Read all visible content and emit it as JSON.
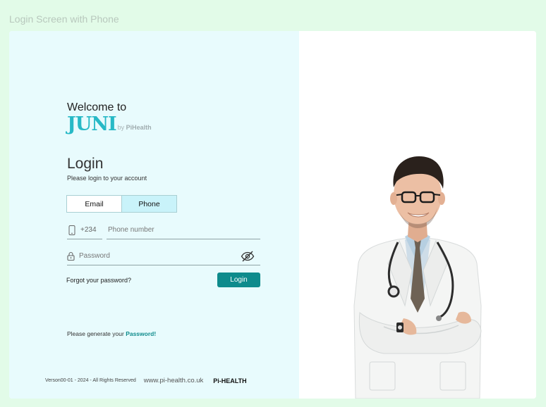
{
  "frame_title": "Login Screen with Phone",
  "welcome": "Welcome to",
  "brand": {
    "name": "JUNI",
    "by": "by",
    "sub": "PiHealth"
  },
  "login": {
    "title": "Login",
    "subtitle": "Please login to your account"
  },
  "tabs": [
    {
      "label": "Email",
      "active": false
    },
    {
      "label": "Phone",
      "active": true
    }
  ],
  "phone": {
    "country_code": "+234",
    "placeholder": "Phone number",
    "value": ""
  },
  "password": {
    "placeholder": "Password",
    "value": ""
  },
  "forgot_label": "Forgot your password?",
  "login_button": "Login",
  "generate": {
    "text": "Please generate your",
    "link": "Password!"
  },
  "footer": {
    "version": "Verson00-01 - 2024 - All Rights Reserved",
    "url": "www.pi-health.co.uk",
    "logo": "Pi-HEALTH"
  },
  "colors": {
    "accent": "#0e8b8c",
    "brand": "#27b9c6",
    "left_panel": "#e8fbfd",
    "active_tab": "#c9f3fa",
    "page_bg": "#e2fbe8"
  },
  "hero_image": "doctor-photo"
}
